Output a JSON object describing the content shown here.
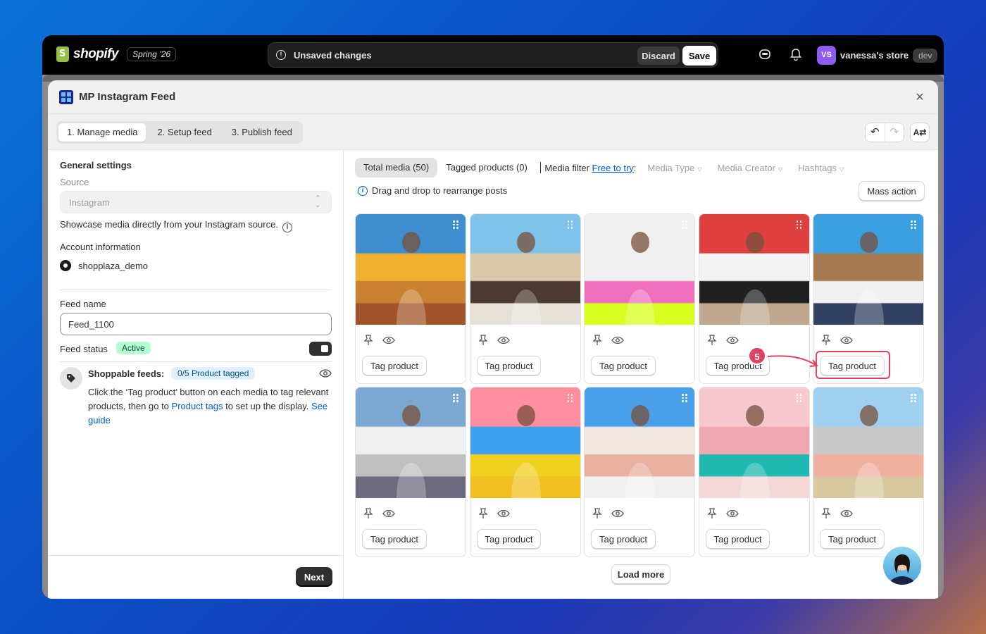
{
  "topbar": {
    "logo_text": "shopify",
    "version_badge": "Spring ’26",
    "unsaved_text": "Unsaved changes",
    "discard_label": "Discard",
    "save_label": "Save",
    "store_initials": "VS",
    "store_name": "vanessa's store",
    "store_badge": "dev"
  },
  "modal": {
    "title": "MP Instagram Feed",
    "steps": [
      "1. Manage media",
      "2. Setup feed",
      "3. Publish feed"
    ],
    "active_step": 0
  },
  "left": {
    "general_title": "General settings",
    "source_label": "Source",
    "source_value": "Instagram",
    "source_help": "Showcase media directly from your Instagram source.",
    "account_title": "Account information",
    "account_name": "shopplaza_demo",
    "feed_name_label": "Feed name",
    "feed_name_value": "Feed_1100",
    "feed_status_label": "Feed status",
    "feed_status_badge": "Active",
    "shoppable_title": "Shoppable feeds:",
    "shoppable_count": "0/5 Product tagged",
    "shoppable_desc_1": "Click the ‘Tag product’ button on each media to tag relevant products, then go to ",
    "shoppable_link": "Product tags",
    "shoppable_desc_2": " to set up the display. ",
    "guide_link": "See guide",
    "next_label": "Next"
  },
  "right": {
    "tab_total": "Total media (50)",
    "tab_tagged": "Tagged products (0)",
    "media_filter": "Media filter",
    "free_to_try": "Free to try",
    "filters": [
      "Media Type",
      "Media Creator",
      "Hashtags"
    ],
    "drag_note": "Drag and drop to rearrange posts",
    "mass_action": "Mass action",
    "tag_label": "Tag product",
    "load_more": "Load more",
    "step_marker": "5"
  },
  "colors": {
    "accent": "#005bd3",
    "highlight": "#e0435f",
    "active_badge": "#b4fed2"
  }
}
